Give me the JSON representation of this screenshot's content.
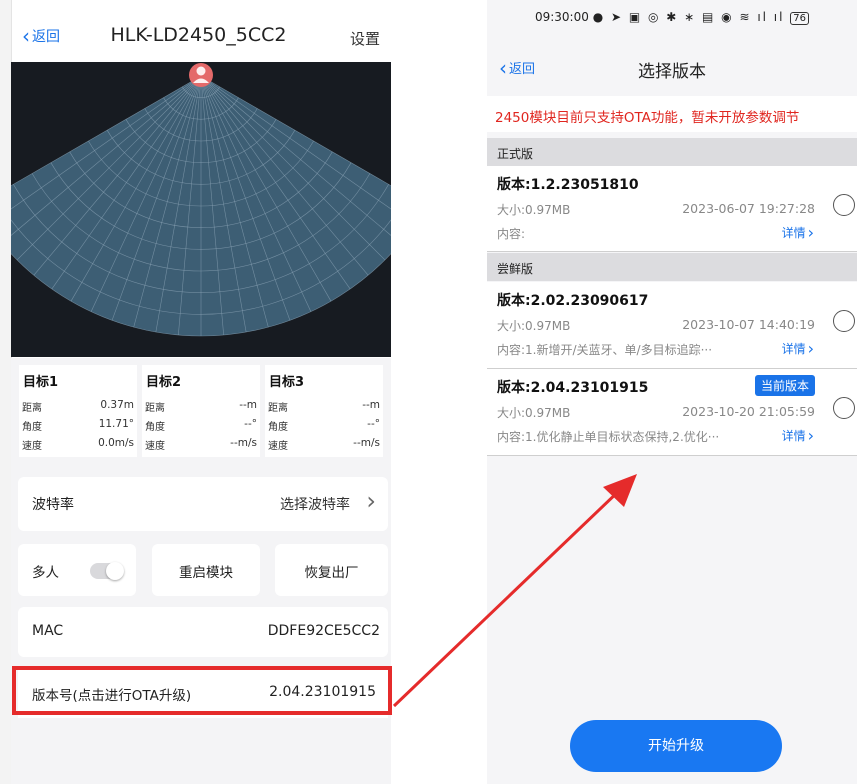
{
  "left_screen": {
    "header": {
      "back_label": "返回",
      "title": "HLK-LD2450_5CC2",
      "settings_label": "设置"
    },
    "targets": [
      {
        "name": "目标1",
        "distance_label": "距离",
        "distance": "0.37m",
        "angle_label": "角度",
        "angle": "11.71°",
        "speed_label": "速度",
        "speed": "0.0m/s"
      },
      {
        "name": "目标2",
        "distance_label": "距离",
        "distance": "--m",
        "angle_label": "角度",
        "angle": "--°",
        "speed_label": "速度",
        "speed": "--m/s"
      },
      {
        "name": "目标3",
        "distance_label": "距离",
        "distance": "--m",
        "angle_label": "角度",
        "angle": "--°",
        "speed_label": "速度",
        "speed": "--m/s"
      }
    ],
    "baud": {
      "label": "波特率",
      "value": "选择波特率"
    },
    "multi_label": "多人",
    "multi_enabled": false,
    "reboot_label": "重启模块",
    "reset_label": "恢复出厂",
    "mac": {
      "label": "MAC",
      "value": "DDFE92CE5CC2"
    },
    "version": {
      "label": "版本号(点击进行OTA升级)",
      "value": "2.04.23101915"
    }
  },
  "right_screen": {
    "status_time": "09:30:00",
    "status_battery": "76",
    "header": {
      "back_label": "返回",
      "title": "选择版本"
    },
    "notice": "2450模块目前只支持OTA功能，暂未开放参数调节",
    "sections": [
      {
        "title": "正式版",
        "items": [
          {
            "version": "版本:1.2.23051810",
            "size": "大小:0.97MB",
            "date": "2023-06-07 19:27:28",
            "content": "内容:",
            "detail": "详情"
          }
        ]
      },
      {
        "title": "尝鲜版",
        "items": [
          {
            "version": "版本:2.02.23090617",
            "size": "大小:0.97MB",
            "date": "2023-10-07 14:40:19",
            "content": "内容:1.新增开/关蓝牙、单/多目标追踪···",
            "detail": "详情"
          },
          {
            "version": "版本:2.04.23101915",
            "badge": "当前版本",
            "size": "大小:0.97MB",
            "date": "2023-10-20 21:05:59",
            "content": "内容:1.优化静止单目标状态保持,2.优化···",
            "detail": "详情"
          }
        ]
      }
    ],
    "start_button": "开始升级"
  },
  "colors": {
    "accent": "#1a73e8",
    "notice_red": "#e0261f",
    "highlight_box": "#e52b2b",
    "radar_fill": "#3d5e74",
    "button_blue": "#1978f2"
  }
}
